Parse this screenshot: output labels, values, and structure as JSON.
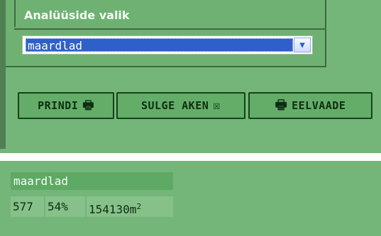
{
  "panel": {
    "title": "Analüüside valik",
    "select": {
      "value": "maardlad",
      "arrow_icon": "chevron-down-icon"
    }
  },
  "toolbar": {
    "print_label": "PRINDI",
    "print_icon": "printer-icon",
    "close_label": "SULGE AKEN",
    "close_icon": "close-box-icon",
    "preview_label": "EELVAADE",
    "preview_icon": "preview-icon"
  },
  "result": {
    "header": "maardlad",
    "count": "577",
    "percent": "54%",
    "area_value": "154130m",
    "area_exp": "2"
  },
  "colors": {
    "background": "#74b679",
    "button_border": "#14431a",
    "select_highlight": "#2f5fc8"
  }
}
